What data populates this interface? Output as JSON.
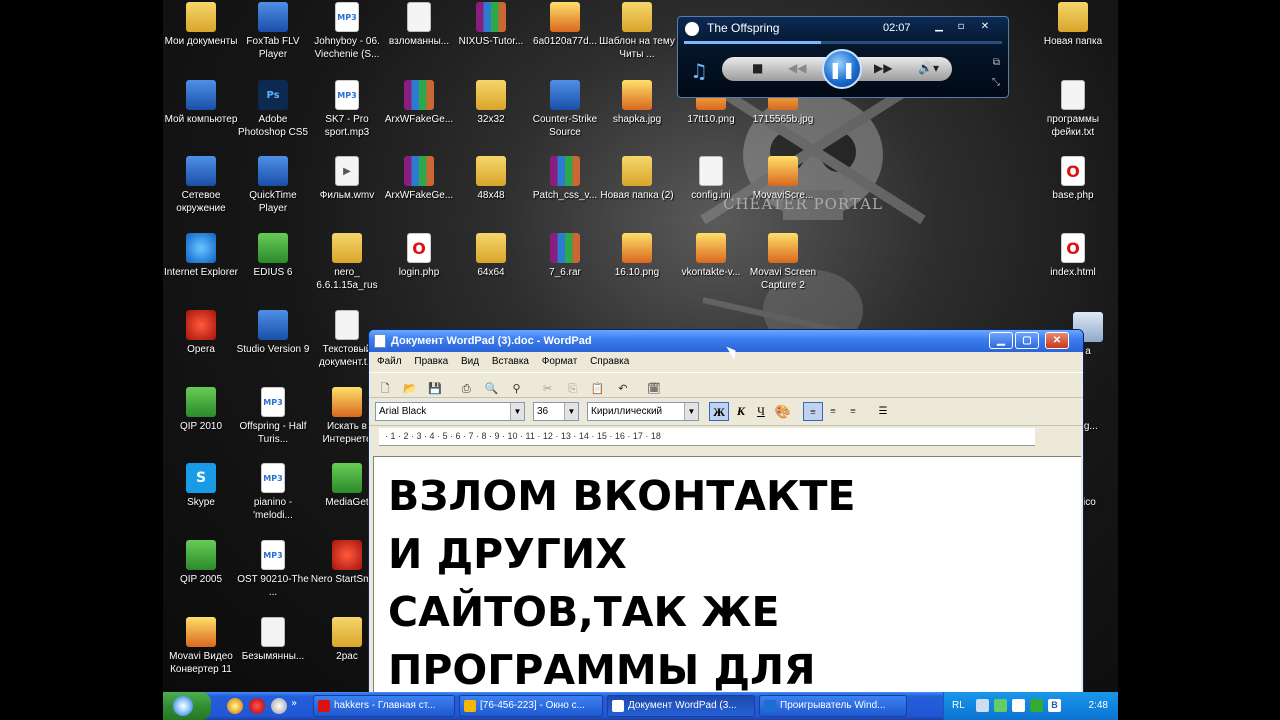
{
  "desktop": {
    "watermark": "CHEATER PORTAL",
    "icons": [
      {
        "label": "Мои документы",
        "kind": "folder"
      },
      {
        "label": "FoxTab FLV Player",
        "kind": "media"
      },
      {
        "label": "Johnyboy - 06. Viechenie (S...",
        "kind": "mp3"
      },
      {
        "label": "взломанны...",
        "kind": "doc"
      },
      {
        "label": "NIXUS-Tutor...",
        "kind": "rar"
      },
      {
        "label": "6a0120a77d...",
        "kind": "img"
      },
      {
        "label": "Шаблон на тему Читы ...",
        "kind": "folder"
      },
      {
        "label": "Новая папка",
        "kind": "folder"
      },
      {
        "label": "Мой компьютер",
        "kind": "computer"
      },
      {
        "label": "Adobe Photoshop CS5",
        "kind": "ps"
      },
      {
        "label": "SK7 - Pro sport.mp3",
        "kind": "mp3"
      },
      {
        "label": "ArxWFakeGe...",
        "kind": "rar"
      },
      {
        "label": "32x32",
        "kind": "folder"
      },
      {
        "label": "Counter-Strike Source",
        "kind": "cs"
      },
      {
        "label": "shapka.jpg",
        "kind": "img"
      },
      {
        "label": "17tt10.png",
        "kind": "img"
      },
      {
        "label": "1715565b.jpg",
        "kind": "img"
      },
      {
        "label": "программы фейки.txt",
        "kind": "doc"
      },
      {
        "label": "Сетевое окружение",
        "kind": "computer"
      },
      {
        "label": "QuickTime Player",
        "kind": "qt"
      },
      {
        "label": "Фильм.wmv",
        "kind": "video"
      },
      {
        "label": "ArxWFakeGe...",
        "kind": "rar"
      },
      {
        "label": "48x48",
        "kind": "folder"
      },
      {
        "label": "Patch_css_v...",
        "kind": "rar"
      },
      {
        "label": "Новая папка (2)",
        "kind": "folder"
      },
      {
        "label": "config.ini",
        "kind": "doc"
      },
      {
        "label": "MovaviScre...",
        "kind": "img"
      },
      {
        "label": "base.php",
        "kind": "opera"
      },
      {
        "label": "Internet Explorer",
        "kind": "ie"
      },
      {
        "label": "EDIUS 6",
        "kind": "green"
      },
      {
        "label": "nero_ 6.6.1.15a_rus",
        "kind": "folder"
      },
      {
        "label": "login.php",
        "kind": "opera"
      },
      {
        "label": "64x64",
        "kind": "folder"
      },
      {
        "label": "7_6.rar",
        "kind": "rar"
      },
      {
        "label": "16.10.png",
        "kind": "img"
      },
      {
        "label": "vkontakte-v...",
        "kind": "img"
      },
      {
        "label": "Movavi Screen Capture 2",
        "kind": "img"
      },
      {
        "label": "index.html",
        "kind": "opera"
      },
      {
        "label": "Opera",
        "kind": "red"
      },
      {
        "label": "Studio Version 9",
        "kind": "blue"
      },
      {
        "label": "Текстовый документ.t...",
        "kind": "doc"
      },
      {
        "label": "QIP 2010",
        "kind": "green"
      },
      {
        "label": "Offspring - Half Turis...",
        "kind": "mp3"
      },
      {
        "label": "Искать в Интернете",
        "kind": "img"
      },
      {
        "label": "Skype",
        "kind": "skype"
      },
      {
        "label": "pianino - 'melodi...",
        "kind": "mp3"
      },
      {
        "label": "MediaGet",
        "kind": "green"
      },
      {
        "label": "QIP 2005",
        "kind": "green"
      },
      {
        "label": "OST 90210-The ...",
        "kind": "mp3"
      },
      {
        "label": "Nero StartSmart",
        "kind": "red"
      },
      {
        "label": "Movavi Видео Конвертер 11",
        "kind": "img"
      },
      {
        "label": "Безымянны...",
        "kind": "doc"
      },
      {
        "label": "2pac",
        "kind": "folder"
      }
    ],
    "right_partial": [
      {
        "label": "a"
      },
      {
        "label": "ug..."
      },
      {
        "label": ".ico"
      }
    ]
  },
  "player": {
    "title": "The Offspring",
    "time": "02:07",
    "progress": 0.43,
    "colors": {
      "accent": "#1c6fd1"
    }
  },
  "wordpad": {
    "title": "Документ WordPad (3).doc - WordPad",
    "menu": [
      "Файл",
      "Правка",
      "Вид",
      "Вставка",
      "Формат",
      "Справка"
    ],
    "font": "Arial Black",
    "size": "36",
    "script": "Кириллический",
    "bold_label": "Ж",
    "italic_label": "К",
    "underline_label": "Ч",
    "ruler": "· 1 · 2 · 3 · 4 · 5 · 6 · 7 · 8 · 9 · 10 · 11 · 12 · 13 · 14 · 15 · 16 · 17 · 18",
    "lines": [
      "ВЗЛОМ ВКОНТАКТЕ",
      "И ДРУГИХ",
      "САЙТОВ,ТАК ЖЕ",
      "ПРОГРАММЫ ДЛЯ"
    ]
  },
  "taskbar": {
    "tasks": [
      {
        "label": "hakkers - Главная ст...",
        "color": "#d11"
      },
      {
        "label": "[76-456-223] - Окно с...",
        "color": "#f5b800"
      },
      {
        "label": "Документ WordPad (3...",
        "color": "#ffffff"
      },
      {
        "label": "Проигрыватель Wind...",
        "color": "#1a6fd1"
      }
    ],
    "lang": "RL",
    "clock": "2:48"
  }
}
